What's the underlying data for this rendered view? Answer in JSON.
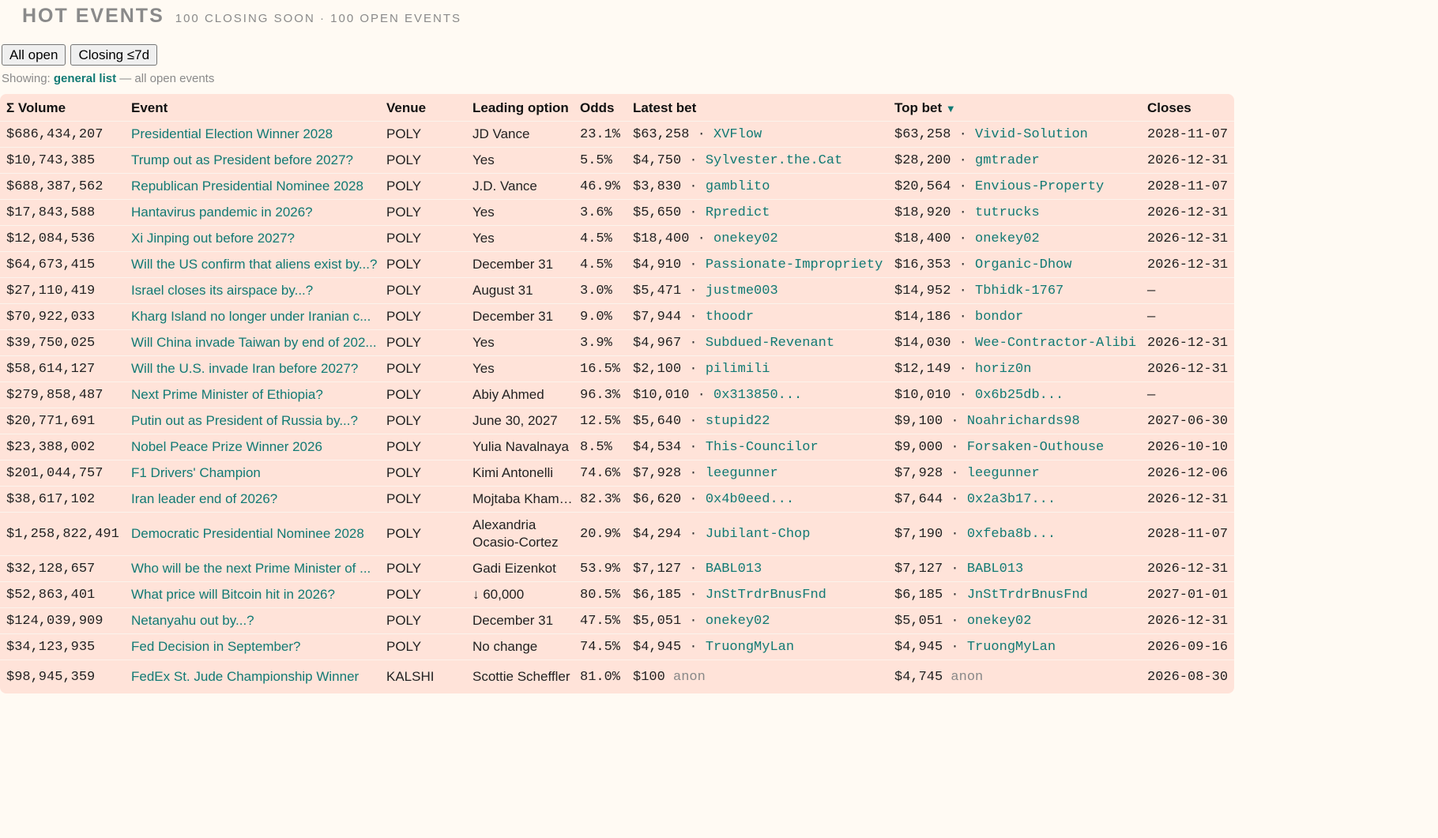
{
  "header": {
    "title": "HOT EVENTS",
    "subtitle": "100 CLOSING SOON · 100 OPEN EVENTS"
  },
  "filters": {
    "all_open": "All open",
    "closing": "Closing ≤7d"
  },
  "showing": {
    "prefix": "Showing:",
    "highlight": "general list",
    "suffix": "— all open events"
  },
  "table": {
    "columns": {
      "volume": "Σ Volume",
      "event": "Event",
      "venue": "Venue",
      "leading": "Leading option",
      "odds": "Odds",
      "latest": "Latest bet",
      "top": "Top bet",
      "top_arrow": "▼",
      "closes": "Closes"
    },
    "rows": [
      {
        "volume": "$686,434,207",
        "event": "Presidential Election Winner 2028",
        "venue": "POLY",
        "leading": "JD Vance",
        "odds": "23.1%",
        "latest_amt": "$63,258",
        "latest_user": "XVFlow",
        "top_amt": "$63,258",
        "top_user": "Vivid-Solution",
        "closes": "2028-11-07"
      },
      {
        "volume": "$10,743,385",
        "event": "Trump out as President before 2027?",
        "venue": "POLY",
        "leading": "Yes",
        "odds": "5.5%",
        "latest_amt": "$4,750",
        "latest_user": "Sylvester.the.Cat",
        "top_amt": "$28,200",
        "top_user": "gmtrader",
        "closes": "2026-12-31"
      },
      {
        "volume": "$688,387,562",
        "event": "Republican Presidential Nominee 2028",
        "venue": "POLY",
        "leading": "J.D. Vance",
        "odds": "46.9%",
        "latest_amt": "$3,830",
        "latest_user": "gamblito",
        "top_amt": "$20,564",
        "top_user": "Envious-Property",
        "closes": "2028-11-07"
      },
      {
        "volume": "$17,843,588",
        "event": "Hantavirus pandemic in 2026?",
        "venue": "POLY",
        "leading": "Yes",
        "odds": "3.6%",
        "latest_amt": "$5,650",
        "latest_user": "Rpredict",
        "top_amt": "$18,920",
        "top_user": "tutrucks",
        "closes": "2026-12-31"
      },
      {
        "volume": "$12,084,536",
        "event": "Xi Jinping out before 2027?",
        "venue": "POLY",
        "leading": "Yes",
        "odds": "4.5%",
        "latest_amt": "$18,400",
        "latest_user": "onekey02",
        "top_amt": "$18,400",
        "top_user": "onekey02",
        "closes": "2026-12-31"
      },
      {
        "volume": "$64,673,415",
        "event": "Will the US confirm that aliens exist by...?",
        "venue": "POLY",
        "leading": "December 31",
        "odds": "4.5%",
        "latest_amt": "$4,910",
        "latest_user": "Passionate-Impropriety",
        "top_amt": "$16,353",
        "top_user": "Organic-Dhow",
        "closes": "2026-12-31"
      },
      {
        "volume": "$27,110,419",
        "event": "Israel closes its airspace by...?",
        "venue": "POLY",
        "leading": "August 31",
        "odds": "3.0%",
        "latest_amt": "$5,471",
        "latest_user": "justme003",
        "top_amt": "$14,952",
        "top_user": "Tbhidk-1767",
        "closes": "—"
      },
      {
        "volume": "$70,922,033",
        "event": "Kharg Island no longer under Iranian c...",
        "venue": "POLY",
        "leading": "December 31",
        "odds": "9.0%",
        "latest_amt": "$7,944",
        "latest_user": "thoodr",
        "top_amt": "$14,186",
        "top_user": "bondor",
        "closes": "—"
      },
      {
        "volume": "$39,750,025",
        "event": "Will China invade Taiwan by end of 202...",
        "venue": "POLY",
        "leading": "Yes",
        "odds": "3.9%",
        "latest_amt": "$4,967",
        "latest_user": "Subdued-Revenant",
        "top_amt": "$14,030",
        "top_user": "Wee-Contractor-Alibi",
        "closes": "2026-12-31"
      },
      {
        "volume": "$58,614,127",
        "event": "Will the U.S. invade Iran before 2027?",
        "venue": "POLY",
        "leading": "Yes",
        "odds": "16.5%",
        "latest_amt": "$2,100",
        "latest_user": "pilimili",
        "top_amt": "$12,149",
        "top_user": "horiz0n",
        "closes": "2026-12-31"
      },
      {
        "volume": "$279,858,487",
        "event": "Next Prime Minister of Ethiopia?",
        "venue": "POLY",
        "leading": "Abiy Ahmed",
        "odds": "96.3%",
        "latest_amt": "$10,010",
        "latest_user": "0x313850...",
        "top_amt": "$10,010",
        "top_user": "0x6b25db...",
        "closes": "—"
      },
      {
        "volume": "$20,771,691",
        "event": "Putin out as President of Russia by...?",
        "venue": "POLY",
        "leading": "June 30, 2027",
        "odds": "12.5%",
        "latest_amt": "$5,640",
        "latest_user": "stupid22",
        "top_amt": "$9,100",
        "top_user": "Noahrichards98",
        "closes": "2027-06-30"
      },
      {
        "volume": "$23,388,002",
        "event": "Nobel Peace Prize Winner 2026",
        "venue": "POLY",
        "leading": "Yulia Navalnaya",
        "odds": "8.5%",
        "latest_amt": "$4,534",
        "latest_user": "This-Councilor",
        "top_amt": "$9,000",
        "top_user": "Forsaken-Outhouse",
        "closes": "2026-10-10"
      },
      {
        "volume": "$201,044,757",
        "event": "F1 Drivers' Champion",
        "venue": "POLY",
        "leading": "Kimi Antonelli",
        "odds": "74.6%",
        "latest_amt": "$7,928",
        "latest_user": "leegunner",
        "top_amt": "$7,928",
        "top_user": "leegunner",
        "closes": "2026-12-06"
      },
      {
        "volume": "$38,617,102",
        "event": "Iran leader end of 2026?",
        "venue": "POLY",
        "leading": "Mojtaba Khamenei",
        "odds": "82.3%",
        "latest_amt": "$6,620",
        "latest_user": "0x4b0eed...",
        "top_amt": "$7,644",
        "top_user": "0x2a3b17...",
        "closes": "2026-12-31"
      },
      {
        "volume": "$1,258,822,491",
        "event": "Democratic Presidential Nominee 2028",
        "venue": "POLY",
        "leading": "Alexandria Ocasio-Cortez",
        "odds": "20.9%",
        "latest_amt": "$4,294",
        "latest_user": "Jubilant-Chop",
        "top_amt": "$7,190",
        "top_user": "0xfeba8b...",
        "closes": "2028-11-07"
      },
      {
        "volume": "$32,128,657",
        "event": "Who will be the next Prime Minister of ...",
        "venue": "POLY",
        "leading": "Gadi Eizenkot",
        "odds": "53.9%",
        "latest_amt": "$7,127",
        "latest_user": "BABL013",
        "top_amt": "$7,127",
        "top_user": "BABL013",
        "closes": "2026-12-31"
      },
      {
        "volume": "$52,863,401",
        "event": "What price will Bitcoin hit in 2026?",
        "venue": "POLY",
        "leading": "↓ 60,000",
        "odds": "80.5%",
        "latest_amt": "$6,185",
        "latest_user": "JnStTrdrBnusFnd",
        "top_amt": "$6,185",
        "top_user": "JnStTrdrBnusFnd",
        "closes": "2027-01-01"
      },
      {
        "volume": "$124,039,909",
        "event": "Netanyahu out by...?",
        "venue": "POLY",
        "leading": "December 31",
        "odds": "47.5%",
        "latest_amt": "$5,051",
        "latest_user": "onekey02",
        "top_amt": "$5,051",
        "top_user": "onekey02",
        "closes": "2026-12-31"
      },
      {
        "volume": "$34,123,935",
        "event": "Fed Decision in September?",
        "venue": "POLY",
        "leading": "No change",
        "odds": "74.5%",
        "latest_amt": "$4,945",
        "latest_user": "TruongMyLan",
        "top_amt": "$4,945",
        "top_user": "TruongMyLan",
        "closes": "2026-09-16"
      },
      {
        "volume": "$98,945,359",
        "event": "FedEx St. Jude Championship Winner",
        "venue": "KALSHI",
        "leading": "Scottie Scheffler",
        "odds": "81.0%",
        "latest_amt": "$100",
        "latest_user": "anon",
        "top_amt": "$4,745",
        "top_user": "anon",
        "closes": "2026-08-30"
      }
    ]
  }
}
